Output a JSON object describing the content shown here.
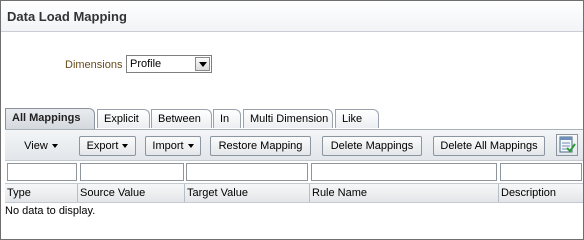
{
  "window": {
    "title": "Data Load Mapping"
  },
  "dimensions": {
    "label": "Dimensions",
    "selected": "Profile"
  },
  "tabs": [
    {
      "label": "All Mappings"
    },
    {
      "label": "Explicit"
    },
    {
      "label": "Between"
    },
    {
      "label": "In"
    },
    {
      "label": "Multi Dimension"
    },
    {
      "label": "Like"
    }
  ],
  "toolbar": {
    "view": "View",
    "export": "Export",
    "import": "Import",
    "restore": "Restore Mapping",
    "delete": "Delete Mappings",
    "delete_all": "Delete All Mappings",
    "action_icon": "checklist-icon"
  },
  "table": {
    "columns": [
      "Type",
      "Source Value",
      "Target Value",
      "Rule Name",
      "Description"
    ],
    "empty_message": "No data to display."
  }
}
